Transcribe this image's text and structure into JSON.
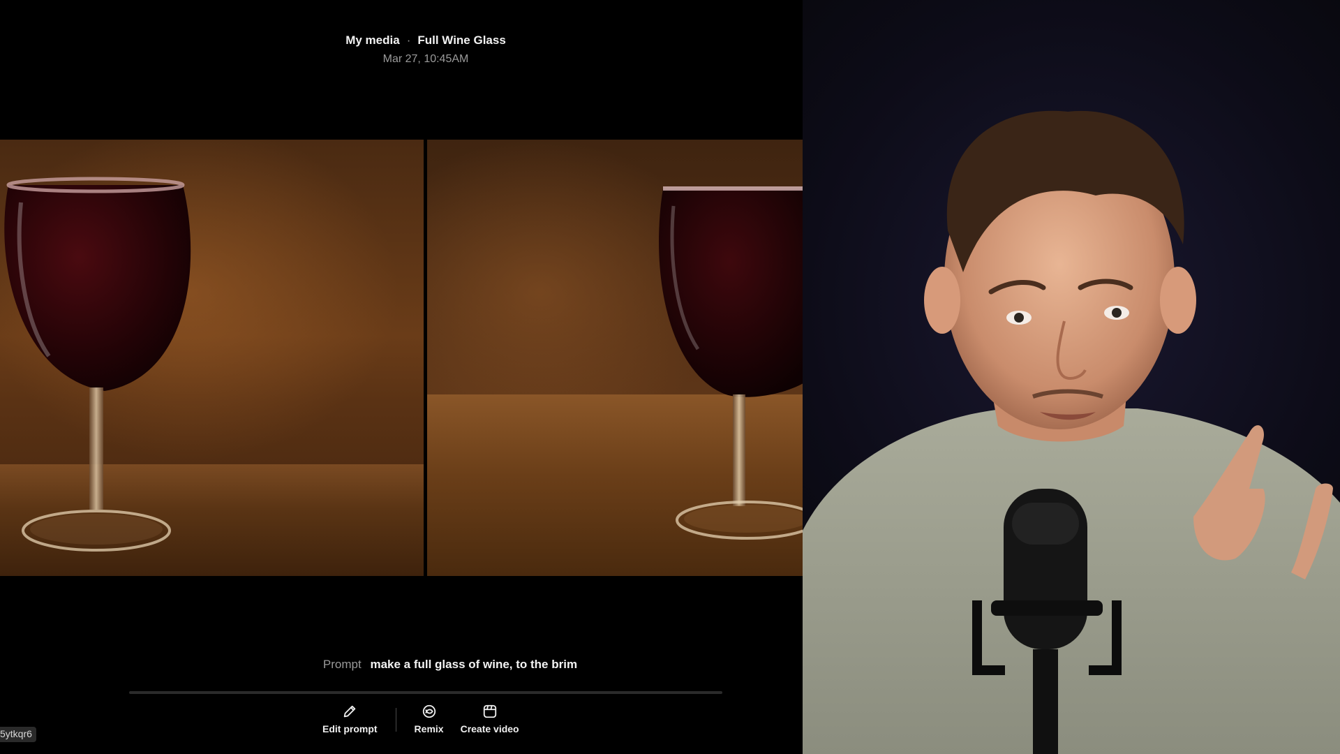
{
  "header": {
    "breadcrumb_root": "My media",
    "separator": "·",
    "breadcrumb_title": "Full Wine Glass",
    "timestamp": "Mar 27, 10:45AM"
  },
  "gallery": {
    "images": [
      {
        "name": "wine-glass-image-1"
      },
      {
        "name": "wine-glass-image-2"
      }
    ]
  },
  "prompt": {
    "label": "Prompt",
    "text": "make a full glass of wine, to the brim"
  },
  "actions": {
    "edit_prompt": {
      "label": "Edit prompt",
      "icon": "pencil-icon"
    },
    "remix": {
      "label": "Remix",
      "icon": "remix-icon"
    },
    "create_video": {
      "label": "Create video",
      "icon": "video-icon"
    }
  },
  "id_badge": "5ytkqr6",
  "colors": {
    "background": "#000000",
    "text_primary": "#f2f2f2",
    "text_secondary": "#9b9b9b",
    "wine": "#2a0508",
    "webcam_glow": "#7a3cc8"
  }
}
